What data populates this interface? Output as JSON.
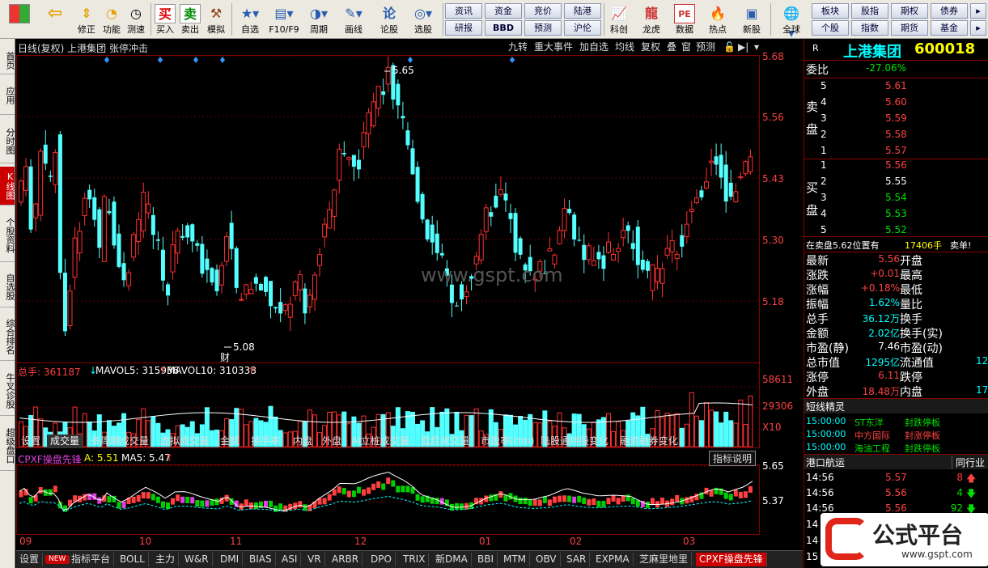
{
  "toolbar": {
    "items": [
      {
        "label": "",
        "icon": "grid-icon"
      },
      {
        "label": "",
        "icon": "back-arrow-icon"
      },
      {
        "label": "修正",
        "icon": "up-down-icon"
      },
      {
        "label": "功能",
        "icon": "func-icon"
      },
      {
        "label": "测速",
        "icon": "clock-icon"
      },
      {
        "label": "买入",
        "icon": "buy-icon"
      },
      {
        "label": "卖出",
        "icon": "sell-icon"
      },
      {
        "label": "模拟",
        "icon": "hammer-icon"
      },
      {
        "label": "自选",
        "icon": "star-icon"
      },
      {
        "label": "F10/F9",
        "icon": "f10-icon"
      },
      {
        "label": "周期",
        "icon": "cycle-icon"
      },
      {
        "label": "画线",
        "icon": "pen-icon"
      },
      {
        "label": "论股",
        "icon": "discuss-icon"
      },
      {
        "label": "选股",
        "icon": "select-icon"
      }
    ],
    "small_buttons_row1": [
      "资讯",
      "资金",
      "竞价",
      "陆港"
    ],
    "small_buttons_row2": [
      "研报",
      "BBD",
      "预测",
      "沪伦"
    ],
    "right_items": [
      {
        "label": "科创",
        "icon": "kc-icon"
      },
      {
        "label": "龙虎",
        "icon": "dragon-icon"
      },
      {
        "label": "数据",
        "icon": "pe-icon"
      },
      {
        "label": "热点",
        "icon": "hot-icon"
      },
      {
        "label": "新股",
        "icon": "new-icon"
      },
      {
        "label": "全球",
        "icon": "globe-icon"
      }
    ],
    "right_row1": [
      "板块",
      "股指",
      "期权",
      "债券"
    ],
    "right_row2": [
      "个股",
      "指数",
      "期货",
      "基金"
    ]
  },
  "leftnav": [
    "首页",
    "应用",
    "分时图",
    "K线图",
    "个股资料",
    "自选股",
    "综合排名",
    "牛叉诊股",
    "超级盘口"
  ],
  "chart": {
    "title": "日线(复权) 上港集团 张停冲击",
    "top_tabs": [
      "九转",
      "重大事件",
      "加自选",
      "均线",
      "复权",
      "叠",
      "窗",
      "预测"
    ],
    "price_levels": [
      "5.68",
      "5.56",
      "5.43",
      "5.30",
      "5.18"
    ],
    "high_label": "5.65",
    "low_label": "5.08",
    "cai_label": "财",
    "watermark": "www.gspt.com",
    "volume_header": {
      "total": "总手: 361187",
      "ma5": "MAVOL5: 315936",
      "ma10": "MAVOL10: 310338"
    },
    "volume_levels": [
      "58611",
      "29306",
      "X10"
    ],
    "indicator_tabs": [
      "设置",
      "成交量",
      "多周期成交量",
      "虚拟成交量",
      "金额",
      "换手率",
      "内盘",
      "外盘",
      "AI立桩成交量",
      "盘后成交量",
      "市盈率(ttm)",
      "陆股通持股变化",
      "融资融券变化"
    ],
    "indicator_header": {
      "name": "CPXF操盘先锋",
      "a": "A: 5.51",
      "ma": "MA5: 5.47"
    },
    "indicator_button": "指标说明",
    "indicator_levels": [
      "5.65",
      "5.37"
    ],
    "months": [
      "09",
      "10",
      "11",
      "12",
      "01",
      "02",
      "03"
    ]
  },
  "bottom_tabs": [
    "设置",
    "NEW",
    "指标平台",
    "BOLL",
    "主力",
    "W&R",
    "DMI",
    "BIAS",
    "ASI",
    "VR",
    "ARBR",
    "DPO",
    "TRIX",
    "新DMA",
    "BBI",
    "MTM",
    "OBV",
    "SAR",
    "EXPMA",
    "芝麻里地里",
    "CPXF操盘先锋"
  ],
  "quote": {
    "r_label": "R",
    "name": "上港集团",
    "code": "600018",
    "weibi_label": "委比",
    "weibi_value": "-27.06%",
    "sell_label": "卖盘",
    "buy_label": "买盘",
    "sell": [
      {
        "n": "5",
        "p": "5.61"
      },
      {
        "n": "4",
        "p": "5.60"
      },
      {
        "n": "3",
        "p": "5.59"
      },
      {
        "n": "2",
        "p": "5.58"
      },
      {
        "n": "1",
        "p": "5.57"
      }
    ],
    "buy": [
      {
        "n": "1",
        "p": "5.56"
      },
      {
        "n": "2",
        "p": "5.55"
      },
      {
        "n": "3",
        "p": "5.54"
      },
      {
        "n": "4",
        "p": "5.53"
      },
      {
        "n": "5",
        "p": "5.52"
      }
    ],
    "notice": "在卖盘5.62位置有",
    "notice_vol": "17406手",
    "notice_tail": "卖单!",
    "stats": [
      {
        "k": "最新",
        "v": "5.56",
        "k2": "开盘"
      },
      {
        "k": "涨跌",
        "v": "+0.01",
        "k2": "最高"
      },
      {
        "k": "涨幅",
        "v": "+0.18%",
        "k2": "最低"
      },
      {
        "k": "振幅",
        "v": "1.62%",
        "k2": "量比"
      },
      {
        "k": "总手",
        "v": "36.12万",
        "k2": "换手"
      },
      {
        "k": "金额",
        "v": "2.02亿",
        "k2": "换手(实)"
      },
      {
        "k": "市盈(静)",
        "v": "7.46",
        "k2": "市盈(动)"
      },
      {
        "k": "总市值",
        "v": "1295亿",
        "k2": "流通值",
        "v2": "12"
      },
      {
        "k": "涨停",
        "v": "6.11",
        "k2": "跌停"
      },
      {
        "k": "外盘",
        "v": "18.48万",
        "k2": "内盘",
        "v2": "17"
      }
    ],
    "short_title": "短线精灵",
    "short": [
      {
        "t": "15:00:00",
        "n": "ST东洋",
        "s": "封跌停板"
      },
      {
        "t": "15:00:00",
        "n": "中方国际",
        "s": "封涨停板"
      },
      {
        "t": "15:00:00",
        "n": "海油工程",
        "s": "封跌停板"
      }
    ],
    "trade_title": "港口航运",
    "trade_right": "同行业",
    "trades": [
      {
        "t": "14:56",
        "p": "5.57",
        "v": "8"
      },
      {
        "t": "14:56",
        "p": "5.56",
        "v": "4"
      },
      {
        "t": "14:56",
        "p": "5.56",
        "v": "92"
      }
    ],
    "trade_more_times": [
      "14",
      "14",
      "15"
    ],
    "logo_text": "公式平台",
    "logo_url": "www.gspt.com"
  }
}
